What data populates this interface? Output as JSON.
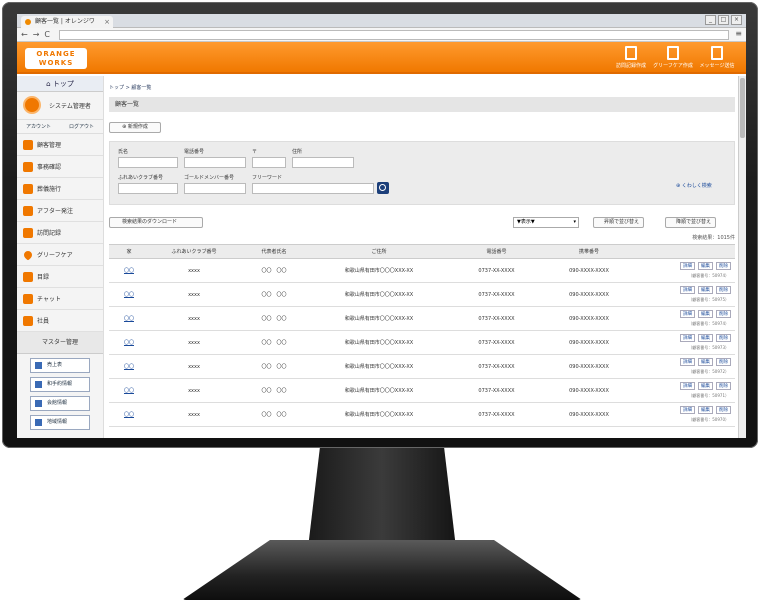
{
  "browser": {
    "tab_title": "顧客一覧 | オレンジワ",
    "tab_close": "×",
    "win_buttons": [
      "_",
      "□",
      "×"
    ],
    "nav": [
      "←",
      "→",
      "C"
    ],
    "menu_icon": "≡"
  },
  "header": {
    "logo": "ORANGE WORKS",
    "buttons": [
      "訪問記録作成",
      "グリーフケア作成",
      "メッセージ送信"
    ]
  },
  "sidebar": {
    "top": "トップ",
    "user_name": "システム管理者",
    "account_link": "アカウント",
    "logout_link": "ログアウト",
    "items": [
      {
        "label": "顧客管理",
        "icon": "house-icon"
      },
      {
        "label": "事務確認",
        "icon": "truck-icon"
      },
      {
        "label": "葬儀施行",
        "icon": "ceremony-icon"
      },
      {
        "label": "アフター発注",
        "icon": "after-order-icon"
      },
      {
        "label": "訪問記録",
        "icon": "visit-icon"
      },
      {
        "label": "グリーフケア",
        "icon": "heart-icon"
      },
      {
        "label": "目録",
        "icon": "catalog-icon"
      },
      {
        "label": "チャット",
        "icon": "chat-icon"
      },
      {
        "label": "社員",
        "icon": "staff-icon"
      }
    ],
    "master": "マスター管理",
    "master_items": [
      "売上表",
      "和手約情報",
      "会館情報",
      "地域情報"
    ]
  },
  "main": {
    "breadcrumb": "トップ > 顧客一覧",
    "title": "顧客一覧",
    "new_button": "新規作成",
    "search": {
      "labels": [
        "氏名",
        "電話番号",
        "〒",
        "住所",
        "ふれあいクラブ番号",
        "ゴールドメンバー番号",
        "フリーワード"
      ],
      "detail_link": "くわしく検索"
    },
    "download_button": "検索結果のダウンロード",
    "sort_select": "▼表示▼",
    "asc_button": "昇順で並び替え",
    "desc_button": "降順で並び替え",
    "result_count": "検索結果：1015件",
    "columns": [
      "家",
      "ふれあいクラブ番号",
      "代表者氏名",
      "ご住所",
      "電話番号",
      "携帯番号"
    ],
    "rows": [
      {
        "house": "〇〇",
        "club": "xxxx",
        "name": "〇〇　〇〇",
        "address": "和歌山県有田市〇〇〇XXX-XX",
        "tel": "0737-XX-XXXX",
        "mobile": "090-XXXX-XXXX",
        "cno": "（顧客番号：50974）"
      },
      {
        "house": "〇〇",
        "club": "xxxx",
        "name": "〇〇　〇〇",
        "address": "和歌山県有田市〇〇〇XXX-XX",
        "tel": "0737-XX-XXXX",
        "mobile": "090-XXXX-XXXX",
        "cno": "（顧客番号：50975）"
      },
      {
        "house": "〇〇",
        "club": "xxxx",
        "name": "〇〇　〇〇",
        "address": "和歌山県有田市〇〇〇XXX-XX",
        "tel": "0737-XX-XXXX",
        "mobile": "090-XXXX-XXXX",
        "cno": "（顧客番号：50974）"
      },
      {
        "house": "〇〇",
        "club": "xxxx",
        "name": "〇〇　〇〇",
        "address": "和歌山県有田市〇〇〇XXX-XX",
        "tel": "0737-XX-XXXX",
        "mobile": "090-XXXX-XXXX",
        "cno": "（顧客番号：50973）"
      },
      {
        "house": "〇〇",
        "club": "xxxx",
        "name": "〇〇　〇〇",
        "address": "和歌山県有田市〇〇〇XXX-XX",
        "tel": "0737-XX-XXXX",
        "mobile": "090-XXXX-XXXX",
        "cno": "（顧客番号：50972）"
      },
      {
        "house": "〇〇",
        "club": "xxxx",
        "name": "〇〇　〇〇",
        "address": "和歌山県有田市〇〇〇XXX-XX",
        "tel": "0737-XX-XXXX",
        "mobile": "090-XXXX-XXXX",
        "cno": "（顧客番号：50971）"
      },
      {
        "house": "〇〇",
        "club": "xxxx",
        "name": "〇〇　〇〇",
        "address": "和歌山県有田市〇〇〇XXX-XX",
        "tel": "0737-XX-XXXX",
        "mobile": "090-XXXX-XXXX",
        "cno": "（顧客番号：50970）"
      }
    ],
    "actions": [
      "詳細",
      "編集",
      "削除"
    ]
  },
  "colors": {
    "brand": "#f07800",
    "link": "#1a4a9a",
    "search_button": "#1c3f7a"
  }
}
